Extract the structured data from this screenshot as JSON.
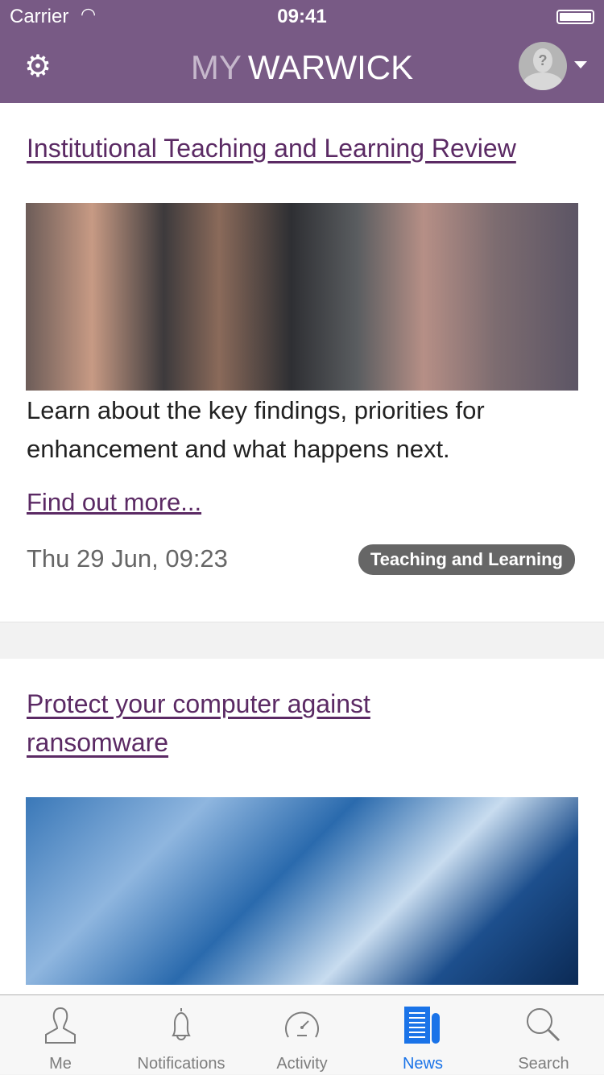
{
  "status_bar": {
    "carrier": "Carrier",
    "time": "09:41"
  },
  "header": {
    "logo_my": "MY",
    "logo_warwick": "WARWICK"
  },
  "news": [
    {
      "title": "Institutional Teaching and Learning Review",
      "summary": "Learn about the key findings, priorities for enhancement and what happens next.",
      "link": "Find out more...",
      "date": "Thu 29 Jun, 09:23",
      "tag": "Teaching and Learning"
    },
    {
      "title": "Protect your computer against ransomware"
    }
  ],
  "tabs": [
    {
      "label": "Me"
    },
    {
      "label": "Notifications"
    },
    {
      "label": "Activity"
    },
    {
      "label": "News",
      "active": true
    },
    {
      "label": "Search"
    }
  ],
  "colors": {
    "brand": "#785a85",
    "link": "#5b2a64",
    "active_tab": "#1a73e8"
  }
}
